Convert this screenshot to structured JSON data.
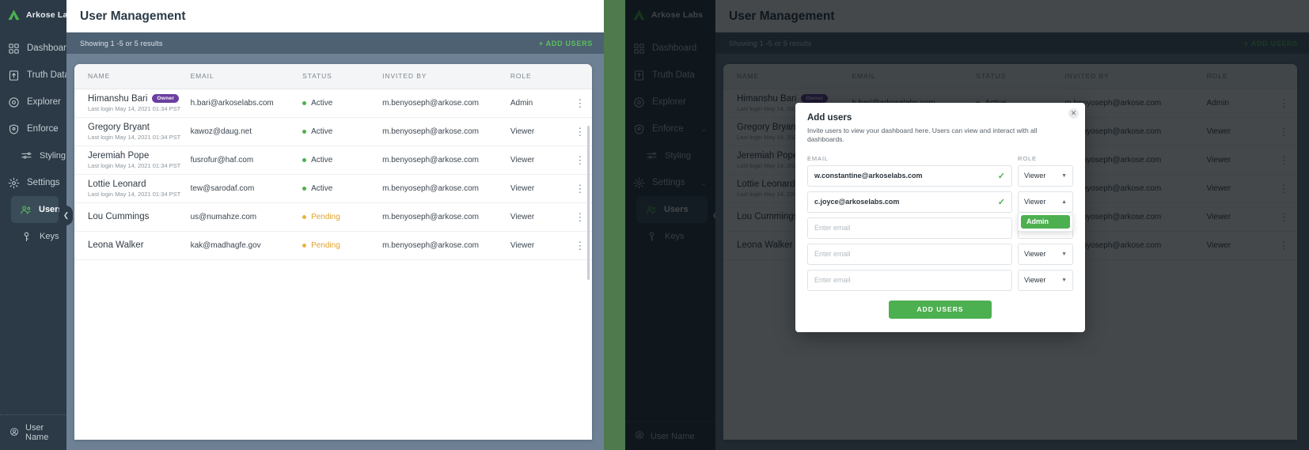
{
  "brand": {
    "name": "Arkose Labs",
    "logo_icon": "arkose-logo-icon"
  },
  "sidebar": {
    "items": [
      {
        "label": "Dashboard",
        "icon": "grid-icon",
        "level": 0,
        "chevron": "",
        "active": false
      },
      {
        "label": "Truth Data",
        "icon": "upload-icon",
        "level": 0,
        "chevron": "",
        "active": false
      },
      {
        "label": "Explorer",
        "icon": "compass-icon",
        "level": 0,
        "chevron": "",
        "active": false
      },
      {
        "label": "Enforce",
        "icon": "shield-icon",
        "level": 0,
        "chevron": "⌄",
        "active": false
      },
      {
        "label": "Styling",
        "icon": "sliders-icon",
        "level": 1,
        "chevron": "",
        "active": false
      },
      {
        "label": "Settings",
        "icon": "gear-icon",
        "level": 0,
        "chevron": "⌄",
        "active": false
      },
      {
        "label": "Users",
        "icon": "users-icon",
        "level": 1,
        "chevron": "",
        "active": true
      },
      {
        "label": "Keys",
        "icon": "key-icon",
        "level": 1,
        "chevron": "",
        "active": false
      }
    ],
    "footer_user": "User Name",
    "collapse_icon": "chevron-left-icon"
  },
  "header": {
    "title": "User Management"
  },
  "subbar": {
    "results_text": "Showing 1 -5 or 5 results",
    "add_users_label": "+ ADD USERS"
  },
  "table": {
    "columns": [
      "NAME",
      "EMAIL",
      "STATUS",
      "INVITED BY",
      "ROLE"
    ],
    "rows": [
      {
        "name": "Himanshu Bari",
        "badge": "Owner",
        "last_login": "Last login May 14, 2021  01:34 PST",
        "email": "h.bari@arkoselabs.com",
        "status": "Active",
        "status_kind": "active",
        "invited_by": "m.benyoseph@arkose.com",
        "role": "Admin",
        "menu_icon": "kebab-menu-icon"
      },
      {
        "name": "Gregory Bryant",
        "badge": "",
        "last_login": "Last login May 14, 2021  01:34 PST",
        "email": "kawoz@daug.net",
        "status": "Active",
        "status_kind": "active",
        "invited_by": "m.benyoseph@arkose.com",
        "role": "Viewer",
        "menu_icon": "kebab-menu-icon"
      },
      {
        "name": "Jeremiah Pope",
        "badge": "",
        "last_login": "Last login May 14, 2021  01:34 PST",
        "email": "fusrofur@haf.com",
        "status": "Active",
        "status_kind": "active",
        "invited_by": "m.benyoseph@arkose.com",
        "role": "Viewer",
        "menu_icon": "kebab-menu-icon"
      },
      {
        "name": "Lottie Leonard",
        "badge": "",
        "last_login": "Last login May 14, 2021  01:34 PST",
        "email": "tew@sarodaf.com",
        "status": "Active",
        "status_kind": "active",
        "invited_by": "m.benyoseph@arkose.com",
        "role": "Viewer",
        "menu_icon": "kebab-menu-icon"
      },
      {
        "name": "Lou Cummings",
        "badge": "",
        "last_login": "",
        "email": "us@numahze.com",
        "status": "Pending",
        "status_kind": "pending",
        "invited_by": "m.benyoseph@arkose.com",
        "role": "Viewer",
        "menu_icon": "kebab-menu-icon"
      },
      {
        "name": "Leona Walker",
        "badge": "",
        "last_login": "",
        "email": "kak@madhagfe.gov",
        "status": "Pending",
        "status_kind": "pending",
        "invited_by": "m.benyoseph@arkose.com",
        "role": "Viewer",
        "menu_icon": "kebab-menu-icon"
      }
    ]
  },
  "modal": {
    "title": "Add users",
    "description": "Invite users to view your dashboard here. Users can view and interact with all dashboards.",
    "close_icon": "close-icon",
    "label_email": "EMAIL",
    "label_role": "ROLE",
    "email_placeholder": "Enter email",
    "valid_icon": "check-icon",
    "caret_down_icon": "chevron-down-icon",
    "caret_up_icon": "chevron-up-icon",
    "rows": [
      {
        "email": "w.constantine@arkoselabs.com",
        "valid": true,
        "role": "Viewer",
        "open": false
      },
      {
        "email": "c.joyce@arkoselabs.com",
        "valid": true,
        "role": "Viewer",
        "open": true
      },
      {
        "email": "",
        "valid": false,
        "role": "Viewer",
        "open": false
      },
      {
        "email": "",
        "valid": false,
        "role": "Viewer",
        "open": false
      },
      {
        "email": "",
        "valid": false,
        "role": "Viewer",
        "open": false
      }
    ],
    "role_options": [
      "Admin"
    ],
    "submit_label": "ADD USERS"
  },
  "colors": {
    "accent_green": "#4caf50",
    "sidebar_bg": "#2b3a46",
    "board_bg": "#6d8094",
    "subbar_bg": "#4e6173",
    "owner_badge": "#6b3fa0",
    "pending": "#e0a32e",
    "page_bg": "#4e7a4e"
  }
}
